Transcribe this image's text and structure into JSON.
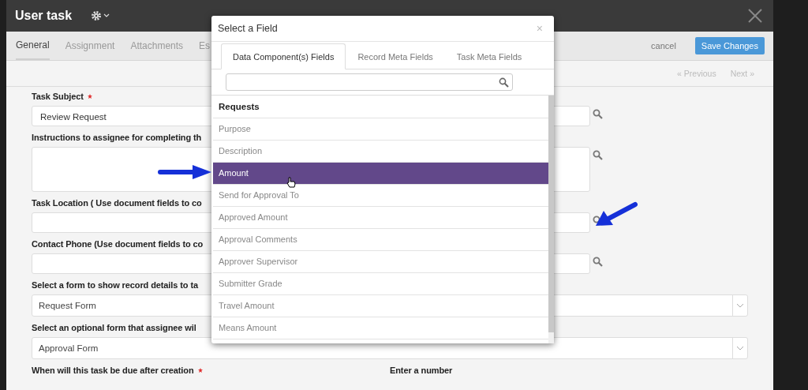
{
  "window": {
    "title": "User task"
  },
  "tabs": [
    {
      "label": "General",
      "selected": true
    },
    {
      "label": "Assignment",
      "selected": false
    },
    {
      "label": "Attachments",
      "selected": false
    },
    {
      "label": "Es",
      "selected": false
    }
  ],
  "actions": {
    "cancel": "cancel",
    "save": "Save Changes"
  },
  "pager": {
    "previous": "« Previous",
    "next": "Next »"
  },
  "form": {
    "fields": [
      {
        "kind": "text",
        "label": "Task Subject",
        "required": true,
        "value": "Review Request"
      },
      {
        "kind": "textarea",
        "label": "Instructions to assignee for completing th",
        "required": false
      },
      {
        "kind": "text",
        "label": "Task Location ( Use document fields to co",
        "required": false
      },
      {
        "kind": "text",
        "label": "Contact Phone (Use document fields to co",
        "required": false
      },
      {
        "kind": "select",
        "label": "Select a form to show record details to ta",
        "required": false,
        "value": "Request Form"
      },
      {
        "kind": "select",
        "label": "Select an optional form that assignee wil",
        "required": false,
        "value": "Approval Form"
      }
    ],
    "due_label": "When will this task be due after creation",
    "due_required": true,
    "number_label": "Enter a number"
  },
  "dialog": {
    "title": "Select a Field",
    "close": "×",
    "tabs": [
      {
        "label": "Data Component(s) Fields",
        "selected": true
      },
      {
        "label": "Record Meta Fields",
        "selected": false
      },
      {
        "label": "Task Meta Fields",
        "selected": false
      }
    ],
    "group": "Requests",
    "items": [
      {
        "label": "Purpose",
        "selected": false
      },
      {
        "label": "Description",
        "selected": false
      },
      {
        "label": "Amount",
        "selected": true
      },
      {
        "label": "Send for Approval To",
        "selected": false
      },
      {
        "label": "Approved Amount",
        "selected": false
      },
      {
        "label": "Approval Comments",
        "selected": false
      },
      {
        "label": "Approver Supervisor",
        "selected": false
      },
      {
        "label": "Submitter Grade",
        "selected": false
      },
      {
        "label": "Travel Amount",
        "selected": false
      },
      {
        "label": "Means Amount",
        "selected": false
      }
    ]
  }
}
